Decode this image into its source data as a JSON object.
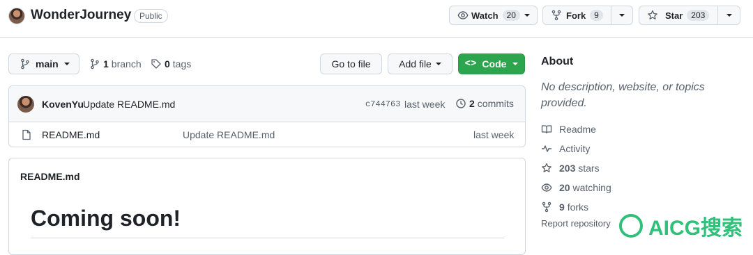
{
  "header": {
    "repo_name": "WonderJourney",
    "visibility": "Public",
    "watch": {
      "label": "Watch",
      "count": "20"
    },
    "fork": {
      "label": "Fork",
      "count": "9"
    },
    "star": {
      "label": "Star",
      "count": "203"
    }
  },
  "toolbar": {
    "branch_selector": "main",
    "branches_count": "1",
    "branches_label": "branch",
    "tags_count": "0",
    "tags_label": "tags",
    "go_to_file": "Go to file",
    "add_file": "Add file",
    "code": "Code"
  },
  "commit": {
    "author": "KovenYu",
    "message": "Update README.md",
    "hash": "c744763",
    "time": "last week",
    "commits_count": "2",
    "commits_label": "commits"
  },
  "files": [
    {
      "name": "README.md",
      "message": "Update README.md",
      "time": "last week"
    }
  ],
  "readme": {
    "title": "README.md",
    "heading": "Coming soon!"
  },
  "about": {
    "title": "About",
    "description": "No description, website, or topics provided.",
    "items": [
      {
        "icon": "book-icon",
        "label": "Readme"
      },
      {
        "icon": "pulse-icon",
        "label": "Activity"
      },
      {
        "icon": "star-icon",
        "count": "203",
        "label": "stars"
      },
      {
        "icon": "eye-icon",
        "count": "20",
        "label": "watching"
      },
      {
        "icon": "fork-icon",
        "count": "9",
        "label": "forks"
      }
    ],
    "report": "Report repository"
  },
  "watermark": {
    "text": "AICG搜索"
  },
  "colors": {
    "primary_green": "#2da44e",
    "border": "#d0d7de",
    "muted": "#57606a"
  }
}
